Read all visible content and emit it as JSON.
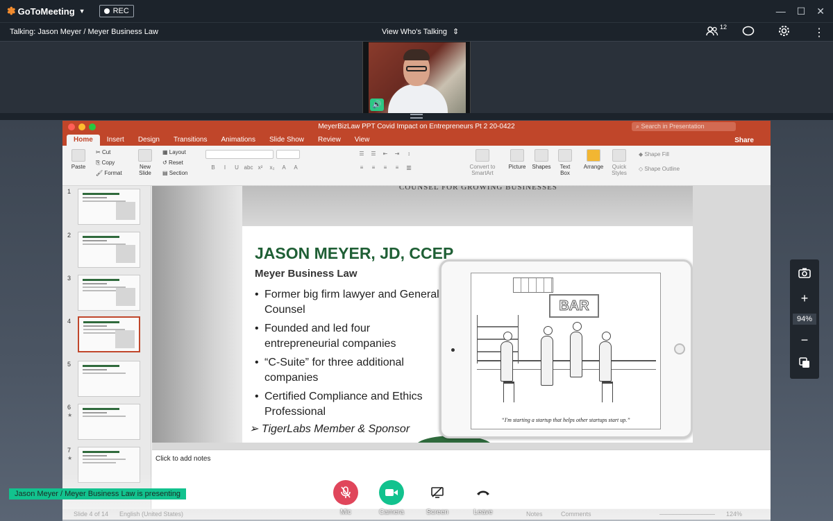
{
  "app": {
    "name": "GoToMeeting",
    "rec": "REC"
  },
  "talkbar": {
    "talking": "Talking: Jason Meyer / Meyer Business Law",
    "view_whos_talking": "View Who's Talking",
    "participants": "12"
  },
  "ppt": {
    "doc_title": "MeyerBizLaw PPT Covid Impact on Entrepreneurs Pt 2 20-0422",
    "search_placeholder": "Search in Presentation",
    "tabs": [
      "Home",
      "Insert",
      "Design",
      "Transitions",
      "Animations",
      "Slide Show",
      "Review",
      "View"
    ],
    "share": "Share",
    "ribbon": {
      "paste": "Paste",
      "cut": "Cut",
      "copy": "Copy",
      "format": "Format",
      "new_slide": "New\nSlide",
      "layout": "Layout",
      "reset": "Reset",
      "section": "Section",
      "convert": "Convert to\nSmartArt",
      "picture": "Picture",
      "shapes": "Shapes",
      "textbox": "Text\nBox",
      "arrange": "Arrange",
      "quick_styles": "Quick\nStyles",
      "shape_fill": "Shape Fill",
      "shape_outline": "Shape Outline"
    },
    "thumbnails": [
      {
        "num": "1",
        "star": ""
      },
      {
        "num": "2",
        "star": ""
      },
      {
        "num": "3",
        "star": ""
      },
      {
        "num": "4",
        "star": ""
      },
      {
        "num": "5",
        "star": ""
      },
      {
        "num": "6",
        "star": "★"
      },
      {
        "num": "7",
        "star": "★"
      }
    ],
    "slide": {
      "header": "COUNSEL FOR GROWING BUSINESSES",
      "title": "JASON MEYER, JD, CCEP",
      "firm": "Meyer Business Law",
      "bullets": [
        "Former big firm lawyer and General Counsel",
        "Founded and led four entrepreneurial companies",
        "“C-Suite” for three additional companies",
        "Certified Compliance and Ethics Professional"
      ],
      "tiger": "➢  TigerLabs Member & Sponsor",
      "cartoon_sign": "BAR",
      "cartoon_caption": "“I'm starting a startup that helps other startups start up.”"
    },
    "notes_placeholder": "Click to add notes",
    "status": {
      "slide": "Slide 4 of 14",
      "language": "English (United States)",
      "notes": "Notes",
      "comments": "Comments",
      "zoom": "124%"
    }
  },
  "zoom_panel": {
    "percent": "94%"
  },
  "controls": [
    {
      "label": "Mic",
      "color": "#e0465b"
    },
    {
      "label": "Camera",
      "color": "#12c28e"
    },
    {
      "label": "Screen",
      "color": "#ffffff"
    },
    {
      "label": "Leave",
      "color": "#ffffff"
    }
  ],
  "presenting": "Jason Meyer / Meyer Business Law is presenting"
}
